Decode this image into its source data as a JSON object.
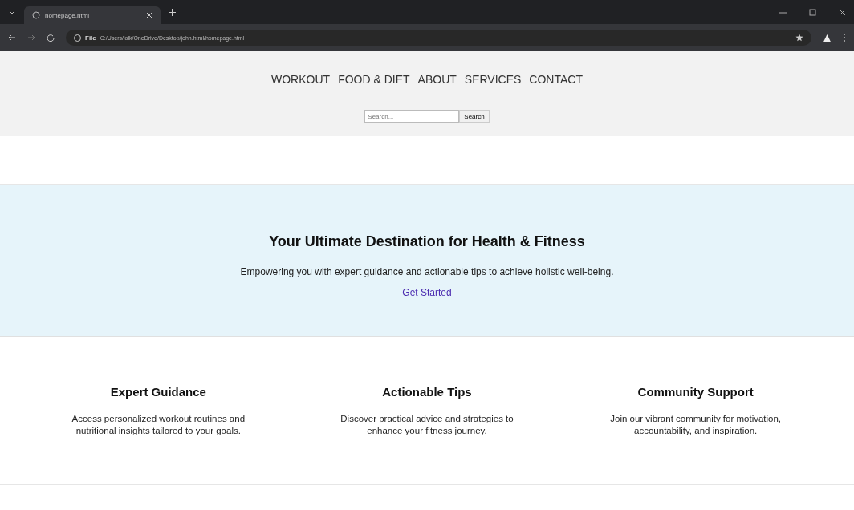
{
  "browser": {
    "tab_title": "homepage.html",
    "address": "C:/Users/lolk/OneDrive/Desktop/john.html/homepage.html",
    "address_prefix": "File"
  },
  "nav": {
    "links": [
      "WORKOUT",
      "FOOD & DIET",
      "ABOUT",
      "SERVICES",
      "CONTACT"
    ]
  },
  "search": {
    "placeholder": "Search...",
    "button": "Search"
  },
  "hero": {
    "title": "Your Ultimate Destination for Health & Fitness",
    "text": "Empowering you with expert guidance and actionable tips to achieve holistic well-being.",
    "link": "Get Started"
  },
  "features": [
    {
      "title": "Expert Guidance",
      "text": "Access personalized workout routines and nutritional insights tailored to your goals."
    },
    {
      "title": "Actionable Tips",
      "text": "Discover practical advice and strategies to enhance your fitness journey."
    },
    {
      "title": "Community Support",
      "text": "Join our vibrant community for motivation, accountability, and inspiration."
    }
  ]
}
